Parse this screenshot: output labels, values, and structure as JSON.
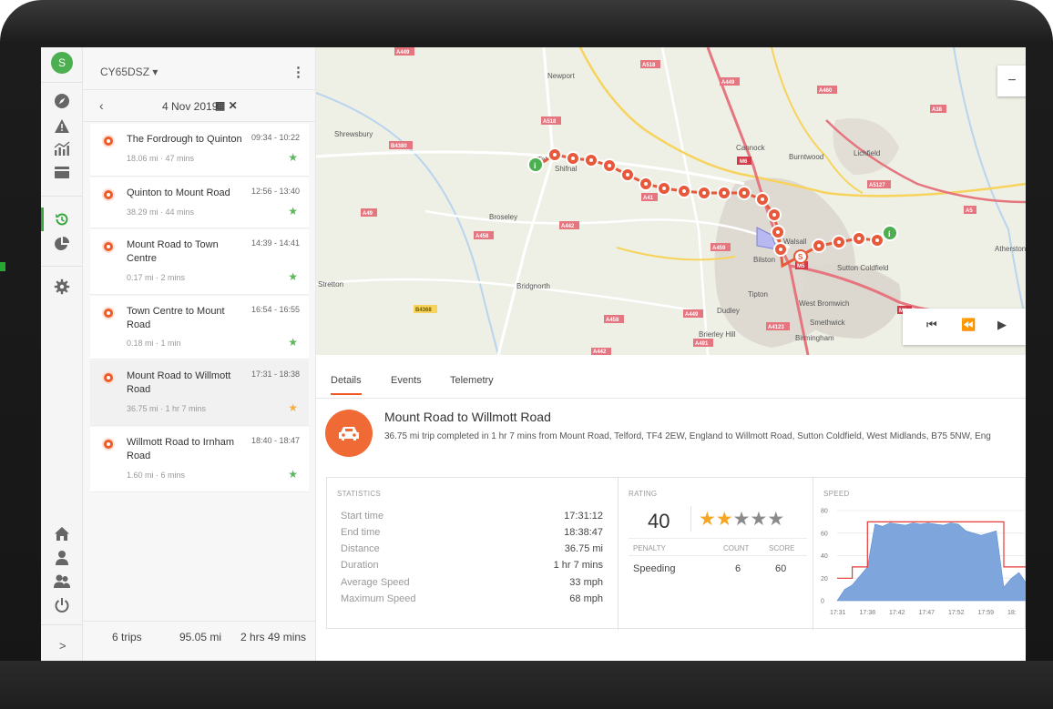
{
  "sidebar": {
    "avatar_initial": "S",
    "icons": [
      "compass-icon",
      "warning-icon",
      "analytics-icon",
      "card-icon",
      "history-icon",
      "pie-chart-icon",
      "settings-icon",
      "home-icon",
      "user-icon",
      "users-icon",
      "power-icon"
    ],
    "active": "history-icon",
    "expand_label": ">"
  },
  "panel": {
    "vehicle": "CY65DSZ ▾",
    "menu_label": "⋮",
    "date_back": "‹",
    "date": "4 Nov 2019",
    "date_icons": "▦ ✕",
    "trips": [
      {
        "name": "The Fordrough to Quinton",
        "time": "09:34 - 10:22",
        "meta": "18.06 mi · 47 mins",
        "star": "★"
      },
      {
        "name": "Quinton to Mount Road",
        "time": "12:56 - 13:40",
        "meta": "38.29 mi · 44 mins",
        "star": "★"
      },
      {
        "name": "Mount Road to Town Centre",
        "time": "14:39 - 14:41",
        "meta": "0.17 mi · 2 mins",
        "star": "★"
      },
      {
        "name": "Town Centre to Mount Road",
        "time": "16:54 - 16:55",
        "meta": "0.18 mi · 1 min",
        "star": "★"
      },
      {
        "name": "Mount Road to Willmott Road",
        "time": "17:31 - 18:38",
        "meta": "36.75 mi · 1 hr 7 mins",
        "star": "★"
      },
      {
        "name": "Willmott Road to Irnham Road",
        "time": "18:40 - 18:47",
        "meta": "1.60 mi · 6 mins",
        "star": "★"
      }
    ],
    "footer": {
      "trips": "6 trips",
      "distance": "95.05 mi",
      "duration": "2 hrs 49 mins"
    }
  },
  "map": {
    "towns": [
      "Newport",
      "Shrewsbury",
      "Cannock",
      "Burntwood",
      "Lichfield",
      "Shifnal",
      "Broseley",
      "Walsall",
      "Bilston",
      "Sutton Coldfield",
      "Atherstone",
      "Stretton",
      "Bridgnorth",
      "Tipton",
      "West Bromwich",
      "Dudley",
      "Smethwick",
      "Birmingham",
      "Brierley Hill"
    ],
    "roads": [
      "A518",
      "A449",
      "A460",
      "A38",
      "A5",
      "B4380",
      "M6",
      "A5127",
      "A41",
      "A49",
      "A442",
      "A458",
      "A459",
      "A4123",
      "A491",
      "B4368",
      "M5"
    ],
    "zoom_label": "−",
    "controls": [
      "⏮",
      "⏪",
      "▶"
    ]
  },
  "tabs": [
    "Details",
    "Events",
    "Telemetry"
  ],
  "active_tab": "Details",
  "trip": {
    "icon": "car-icon",
    "title": "Mount Road to Willmott Road",
    "description": "36.75 mi trip completed in 1 hr 7 mins from Mount Road, Telford, TF4 2EW, England to Willmott Road, Sutton Coldfield, West Midlands, B75 5NW, Eng"
  },
  "statistics": {
    "heading": "STATISTICS",
    "rows": [
      {
        "label": "Start time",
        "value": "17:31:12"
      },
      {
        "label": "End time",
        "value": "18:38:47"
      },
      {
        "label": "Distance",
        "value": "36.75 mi"
      },
      {
        "label": "Duration",
        "value": "1 hr 7 mins"
      },
      {
        "label": "Average Speed",
        "value": "33 mph"
      },
      {
        "label": "Maximum Speed",
        "value": "68 mph"
      }
    ]
  },
  "rating": {
    "heading": "RATING",
    "score": "40",
    "stars_filled": 2,
    "stars_total": 5,
    "columns": [
      "PENALTY",
      "COUNT",
      "SCORE"
    ],
    "rows": [
      {
        "penalty": "Speeding",
        "count": "6",
        "score": "60"
      }
    ]
  },
  "colors": {
    "accent": "#f05a28",
    "green": "#3aa63f",
    "star": "#f5a623",
    "speed_fill": "#6f9fd8",
    "limit_line": "#e53935"
  },
  "chart_data": {
    "type": "area",
    "title": "SPEED",
    "xlabel": "",
    "ylabel": "",
    "x_ticks": [
      "17:31",
      "17:38",
      "17:42",
      "17:47",
      "17:52",
      "17:59",
      "18:"
    ],
    "y_ticks": [
      0,
      20,
      40,
      60,
      80
    ],
    "ylim": [
      0,
      80
    ],
    "series": [
      {
        "values": [
          0,
          10,
          14,
          22,
          30,
          68,
          66,
          69,
          68,
          67,
          69,
          68,
          69,
          68,
          67,
          69,
          68,
          62,
          60,
          58,
          60,
          62,
          12,
          20,
          25,
          15
        ]
      },
      {
        "values": [
          20,
          20,
          30,
          30,
          70,
          70,
          70,
          70,
          70,
          70,
          70,
          70,
          70,
          70,
          70,
          70,
          70,
          70,
          70,
          70,
          70,
          70,
          30,
          30,
          30,
          30
        ]
      }
    ]
  }
}
